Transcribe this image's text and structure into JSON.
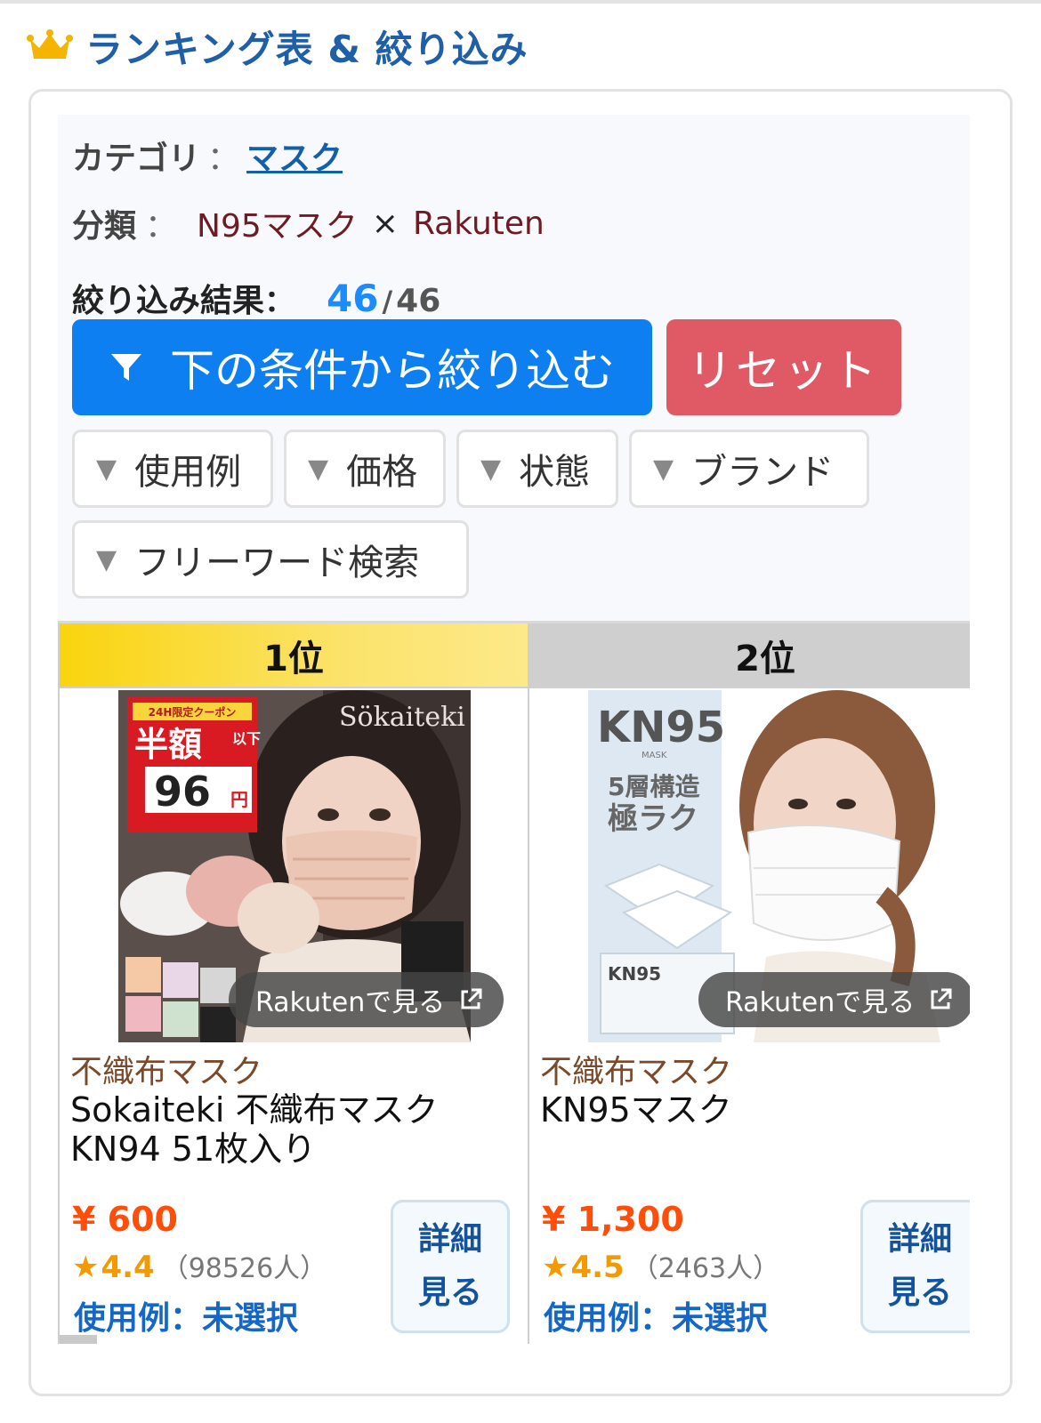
{
  "header": {
    "title": "ランキング表 & 絞り込み"
  },
  "category": {
    "label": "カテゴリ",
    "separator": "：",
    "value": "マスク"
  },
  "classification": {
    "label": "分類",
    "separator": "：",
    "value1": "N95マスク",
    "times": "×",
    "value2": "Rakuten"
  },
  "result": {
    "label": "絞り込み結果",
    "separator": "：",
    "count": "46",
    "slash": "/",
    "total": "46"
  },
  "buttons": {
    "filter_label": "下の条件から絞り込む",
    "reset_label": "リセット"
  },
  "filters": [
    {
      "label": "使用例"
    },
    {
      "label": "価格"
    },
    {
      "label": "状態"
    },
    {
      "label": "ブランド"
    },
    {
      "label": "フリーワード検索"
    }
  ],
  "filter_arrow": "▼",
  "products": [
    {
      "rank": "1位",
      "image": {
        "brand": "Sökaiteki",
        "banner": "24H限定クーポン",
        "half": "半額",
        "below": "以下",
        "price": "96",
        "yen": "円"
      },
      "rakuten_label": "Rakutenで見る",
      "category": "不織布マスク",
      "name": "Sokaiteki 不織布マスク KN94 51枚入り",
      "price": "¥ 600",
      "star": "★",
      "rating": "4.4",
      "reviews": "（98526人）",
      "usage": "使用例：未選択",
      "detail_line1": "詳細",
      "detail_line2": "見る"
    },
    {
      "rank": "2位",
      "image": {
        "brand": "KN95",
        "sub": "MASK",
        "line1": "5層構造",
        "line2": "極ラク",
        "badge": "KN95"
      },
      "rakuten_label": "Rakutenで見る",
      "category": "不織布マスク",
      "name": "KN95マスク",
      "price": "¥ 1,300",
      "star": "★",
      "rating": "4.5",
      "reviews": "（2463人）",
      "usage": "使用例：未選択",
      "detail_line1": "詳細",
      "detail_line2": "見る"
    }
  ],
  "colors": {
    "accent_blue": "#0d7ff0",
    "reset_red": "#e05a66",
    "gold": "#f9d40e",
    "price_orange": "#ff4d0a",
    "title_blue": "#1f5fa8"
  }
}
